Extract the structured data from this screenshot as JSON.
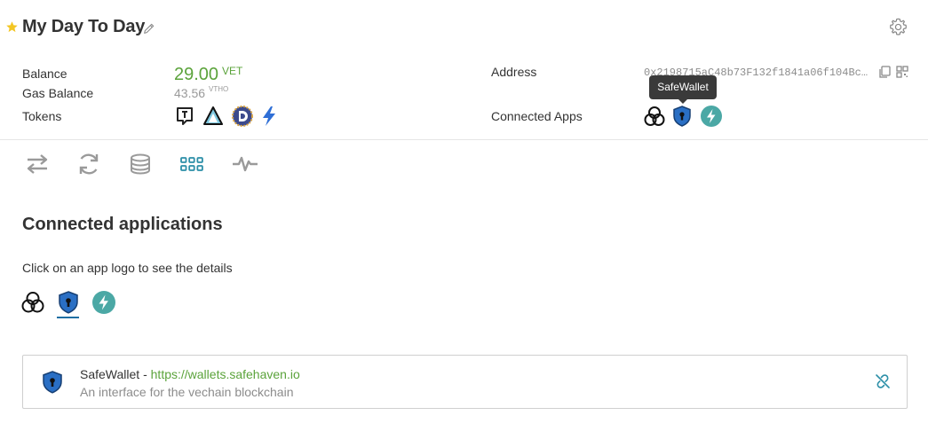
{
  "wallet": {
    "name": "My Day To Day"
  },
  "summary": {
    "balance_label": "Balance",
    "balance_value": "29.00",
    "balance_unit": "VET",
    "gas_label": "Gas Balance",
    "gas_value": "43.56",
    "gas_unit": "VTHO",
    "tokens_label": "Tokens",
    "tokens": [
      "token-t-icon",
      "token-triangle-icon",
      "token-d-icon",
      "token-bolt-icon"
    ],
    "address_label": "Address",
    "address_value": "0x2198715aC48b73F132f1841a06f104Bc…",
    "connected_apps_label": "Connected Apps",
    "connected_apps": [
      "trinity-app-icon",
      "safewallet-app-icon",
      "bolt-app-icon"
    ],
    "tooltip": "SafeWallet"
  },
  "tabs": [
    {
      "icon": "transfer-icon",
      "active": false
    },
    {
      "icon": "refresh-icon",
      "active": false
    },
    {
      "icon": "coins-icon",
      "active": false
    },
    {
      "icon": "apps-grid-icon",
      "active": true
    },
    {
      "icon": "activity-icon",
      "active": false
    }
  ],
  "connected_section": {
    "title": "Connected applications",
    "hint": "Click on an app logo to see the details",
    "selected_app": "SafeWallet"
  },
  "detail": {
    "name": "SafeWallet",
    "separator": " - ",
    "url": "https://wallets.safehaven.io",
    "description": "An interface for the vechain blockchain"
  },
  "colors": {
    "accent_green": "#5ba33b",
    "accent_teal": "#2c8fa8",
    "muted": "#8c8c8c"
  }
}
